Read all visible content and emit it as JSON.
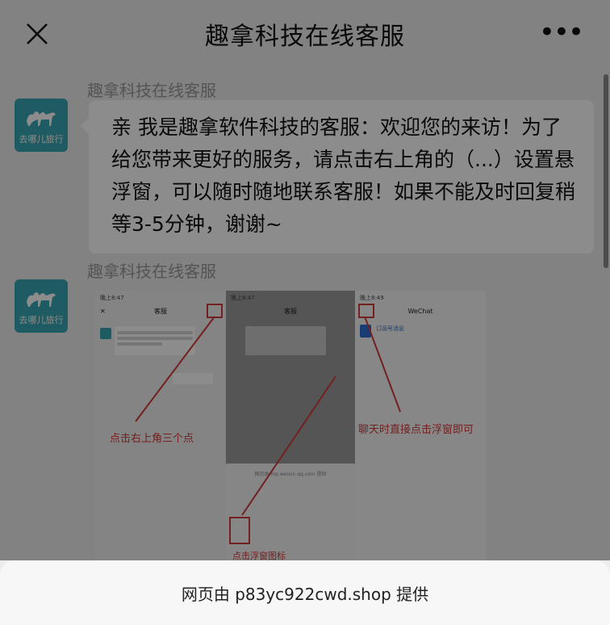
{
  "header": {
    "title": "趣拿科技在线客服"
  },
  "messages": [
    {
      "sender": "趣拿科技在线客服",
      "avatar_text": "去哪儿旅行",
      "text": "亲 我是趣拿软件科技的客服：欢迎您的来访！为了给您带来更好的服务，请点击右上角的（...）设置悬浮窗，可以随时随地联系客服！如果不能及时回复稍等3-5分钟，谢谢~"
    },
    {
      "sender": "趣拿科技在线客服",
      "avatar_text": "去哪儿旅行",
      "image": {
        "pane1": {
          "status": "晚上8:47",
          "nav_title": "客服",
          "annotation": "点击右上角三个点"
        },
        "pane2": {
          "status": "晚上8:47",
          "nav_title": "客服",
          "sheet_title": "网页由 mp.weixin.qq.com 提供",
          "annotation": "点击浮窗图标"
        },
        "pane3": {
          "status": "晚上8:49",
          "nav_title": "WeChat",
          "item": "订阅号消息",
          "annotation": "聊天时直接点击浮窗即可"
        }
      }
    }
  ],
  "footer": {
    "provider_text": "网页由 p83yc922cwd.shop 提供"
  },
  "colors": {
    "accent_red": "#d23b3b",
    "avatar_bg": "#3aa7b3"
  },
  "icons": [
    "close-icon",
    "more-icon",
    "camel-logo-icon"
  ]
}
